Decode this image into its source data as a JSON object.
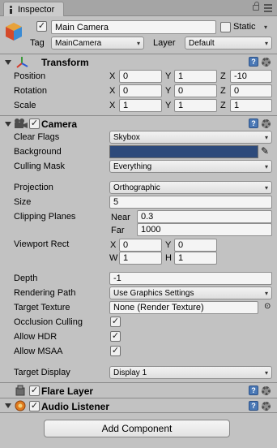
{
  "tab": {
    "label": "Inspector"
  },
  "object": {
    "name": "Main Camera",
    "static_label": "Static",
    "tag_label": "Tag",
    "tag_value": "MainCamera",
    "layer_label": "Layer",
    "layer_value": "Default"
  },
  "transform": {
    "title": "Transform",
    "position": {
      "label": "Position",
      "x": "0",
      "y": "1",
      "z": "-10"
    },
    "rotation": {
      "label": "Rotation",
      "x": "0",
      "y": "0",
      "z": "0"
    },
    "scale": {
      "label": "Scale",
      "x": "1",
      "y": "1",
      "z": "1"
    },
    "axis_x": "X",
    "axis_y": "Y",
    "axis_z": "Z"
  },
  "camera": {
    "title": "Camera",
    "clear_flags": {
      "label": "Clear Flags",
      "value": "Skybox"
    },
    "background": {
      "label": "Background",
      "color": "#2d4a7b"
    },
    "culling_mask": {
      "label": "Culling Mask",
      "value": "Everything"
    },
    "projection": {
      "label": "Projection",
      "value": "Orthographic"
    },
    "size": {
      "label": "Size",
      "value": "5"
    },
    "clipping": {
      "label": "Clipping Planes",
      "near_label": "Near",
      "near": "0.3",
      "far_label": "Far",
      "far": "1000"
    },
    "viewport": {
      "label": "Viewport Rect",
      "x_label": "X",
      "x": "0",
      "y_label": "Y",
      "y": "0",
      "w_label": "W",
      "w": "1",
      "h_label": "H",
      "h": "1"
    },
    "depth": {
      "label": "Depth",
      "value": "-1"
    },
    "rendering_path": {
      "label": "Rendering Path",
      "value": "Use Graphics Settings"
    },
    "target_texture": {
      "label": "Target Texture",
      "value": "None (Render Texture)"
    },
    "occlusion_culling": {
      "label": "Occlusion Culling",
      "checked": true
    },
    "allow_hdr": {
      "label": "Allow HDR",
      "checked": true
    },
    "allow_msaa": {
      "label": "Allow MSAA",
      "checked": true
    },
    "target_display": {
      "label": "Target Display",
      "value": "Display 1"
    }
  },
  "flare_layer": {
    "title": "Flare Layer"
  },
  "audio_listener": {
    "title": "Audio Listener"
  },
  "add_component": {
    "label": "Add Component"
  },
  "glyphs": {
    "check": "✓",
    "dropdown_arrow": "▾",
    "help": "?",
    "object_picker": "⊙",
    "eyedropper": "✎"
  },
  "colors": {
    "panel_bg": "#c2c2c2",
    "help_blue": "#4a78b5",
    "background_swatch": "#2d4a7b"
  }
}
